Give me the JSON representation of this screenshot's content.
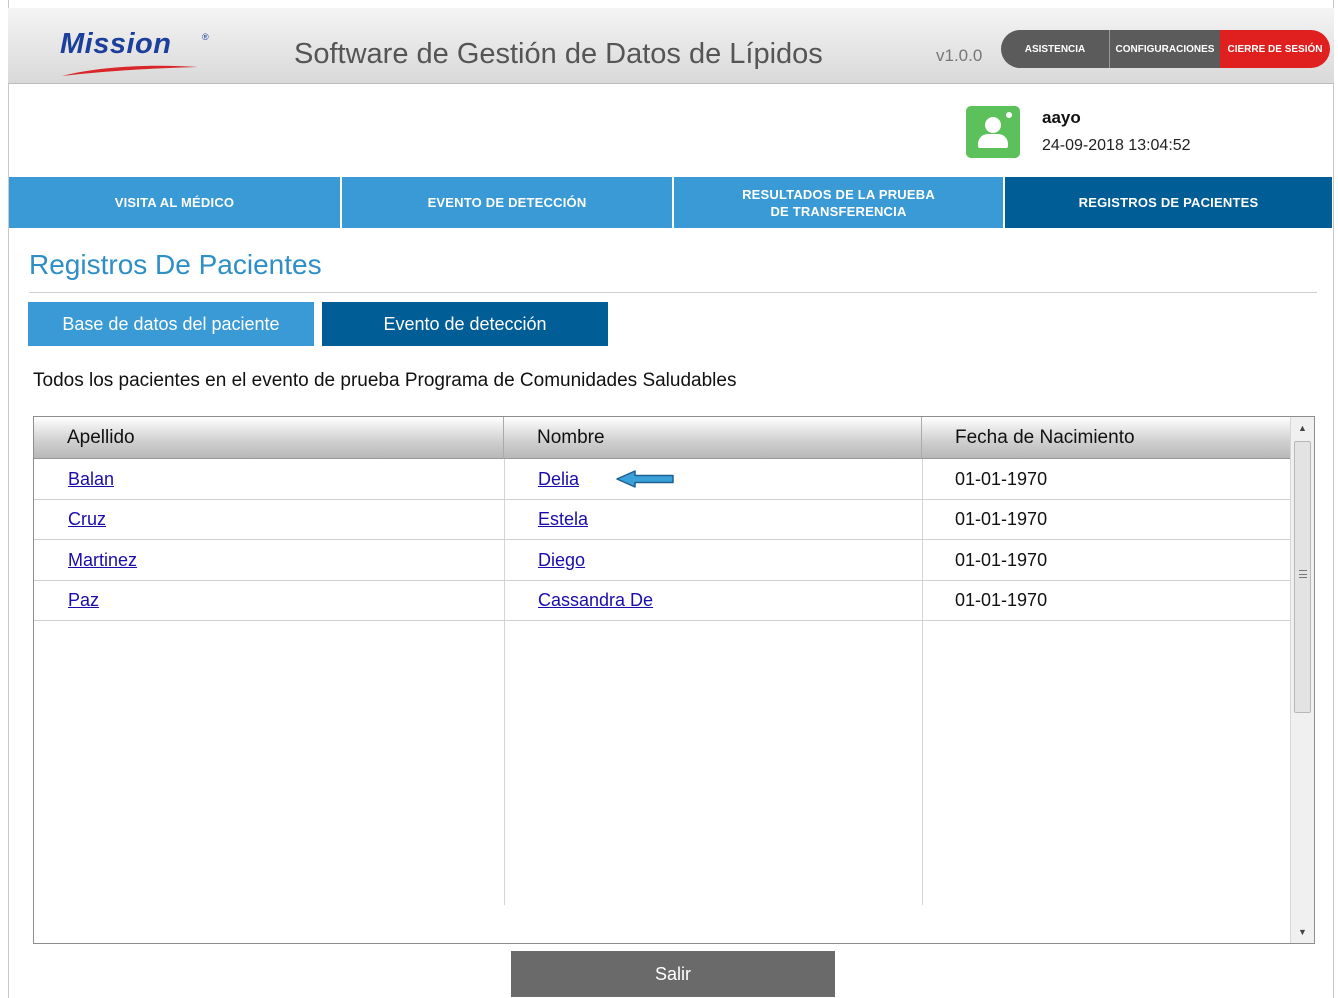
{
  "header": {
    "logo_text": "Mission",
    "logo_mark": "®",
    "app_title": "Software de Gestión de Datos de Lípidos",
    "version": "v1.0.0",
    "buttons": {
      "assistance": "ASISTENCIA",
      "settings": "CONFIGURACIONES",
      "logout": "CIERRE DE SESIÓN"
    },
    "colors": {
      "logo_blue": "#1b3f9a",
      "logout_red": "#e0201f",
      "dark_btn": "#5b5b5b"
    }
  },
  "user": {
    "name": "aayo",
    "datetime": "24-09-2018 13:04:52",
    "avatar_icon": "user-avatar-icon"
  },
  "nav": {
    "items": [
      {
        "label": "VISITA AL MÉDICO"
      },
      {
        "label": "EVENTO DE DETECCIÓN"
      },
      {
        "label": "RESULTADOS DE LA PRUEBA DE TRANSFERENCIA"
      },
      {
        "label": "REGISTROS DE PACIENTES"
      }
    ],
    "active_index": 3,
    "colors": {
      "normal": "#3a9ad5",
      "active": "#005d96"
    }
  },
  "page": {
    "title": "Registros De Pacientes",
    "subtabs": [
      {
        "label": "Base de datos del paciente"
      },
      {
        "label": "Evento de detección"
      }
    ],
    "active_subtab": 1,
    "description": "Todos los pacientes en el evento de prueba Programa de Comunidades Saludables"
  },
  "table": {
    "columns": [
      "Apellido",
      "Nombre",
      "Fecha de Nacimiento"
    ],
    "rows": [
      {
        "apellido": "Balan",
        "nombre": "Delia",
        "fecha": "01-01-1970"
      },
      {
        "apellido": "Cruz",
        "nombre": "Estela",
        "fecha": "01-01-1970"
      },
      {
        "apellido": "Martinez",
        "nombre": "Diego",
        "fecha": "01-01-1970"
      },
      {
        "apellido": "Paz",
        "nombre": "Cassandra De",
        "fecha": "01-01-1970"
      }
    ],
    "pointer_icon": "left-arrow-icon"
  },
  "footer": {
    "exit_label": "Salir"
  }
}
